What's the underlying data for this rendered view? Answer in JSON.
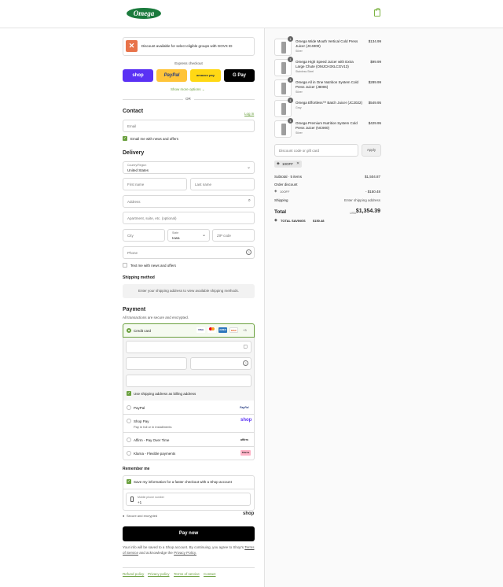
{
  "header": {
    "logo_text": "Omega"
  },
  "discount_banner": {
    "text": "Discount available for select eligible groups with GOVX ID"
  },
  "express": {
    "title": "Express checkout",
    "buttons": [
      {
        "label": "shop",
        "bg": "#5a31f4",
        "color": "#ffffff"
      },
      {
        "label": "PayPal",
        "bg": "#ffc439",
        "color": "#253b80"
      },
      {
        "label": "amazon pay",
        "bg": "#ffd814",
        "color": "#232f3e"
      },
      {
        "label": "G Pay",
        "bg": "#000000",
        "color": "#ffffff"
      }
    ],
    "show_more": "Show more options",
    "or": "OR"
  },
  "contact": {
    "title": "Contact",
    "login": "Log in",
    "email_placeholder": "Email",
    "email_news": "Email me with news and offers"
  },
  "delivery": {
    "title": "Delivery",
    "country_label": "Country/Region",
    "country_value": "United States",
    "first_name": "First name",
    "last_name": "Last name",
    "address": "Address",
    "apartment": "Apartment, suite, etc. (optional)",
    "city": "City",
    "state_label": "State",
    "state_value": "Iowa",
    "zip": "ZIP code",
    "phone": "Phone",
    "text_news": "Text me with news and offers"
  },
  "shipping": {
    "title": "Shipping method",
    "notice": "Enter your shipping address to view available shipping methods."
  },
  "payment": {
    "title": "Payment",
    "subtitle": "All transactions are secure and encrypted.",
    "credit_card": "Credit card",
    "card_logos": [
      "VISA",
      "MC",
      "AMEX",
      "DISC"
    ],
    "more_cards": "+3",
    "billing_same": "Use shipping address as billing address",
    "methods": [
      {
        "label": "PayPal",
        "sub": "",
        "logo": "PayPal"
      },
      {
        "label": "Shop Pay",
        "sub": "Pay in full or in installments",
        "logo": "shop"
      },
      {
        "label": "Affirm - Pay Over Time",
        "sub": "",
        "logo": "affirm"
      },
      {
        "label": "Klarna - Flexible payments",
        "sub": "",
        "logo": "Klarna"
      }
    ]
  },
  "remember": {
    "title": "Remember me",
    "save_info": "Save my information for a faster checkout with a Shop account",
    "mobile_label": "Mobile phone number",
    "mobile_value": "+1",
    "secure": "Secure and encrypted",
    "shop_logo": "shop"
  },
  "pay_now": "Pay now",
  "legal": {
    "text_before": "Your info will be saved to a Shop account. By continuing, you agree to Shop's",
    "terms": "Terms of Service",
    "and": "and acknowledge the",
    "privacy": "Privacy Policy."
  },
  "footer_links": [
    "Refund policy",
    "Privacy policy",
    "Terms of service",
    "Contact"
  ],
  "cart": {
    "items": [
      {
        "qty": "1",
        "name": "Omega Wide Mouth Vertical Cold Press Juicer (JC4000)",
        "variant": "Silver",
        "price": "$134.99"
      },
      {
        "qty": "1",
        "name": "Omega High Speed Juicer with Extra Large Chute (OMJCH3XLCGV13)",
        "variant": "Stainless Steel",
        "price": "$99.99"
      },
      {
        "qty": "1",
        "name": "Omega All in One Nutrition System Cold Press Juicer (J8006)",
        "variant": "Silver",
        "price": "$289.99"
      },
      {
        "qty": "1",
        "name": "Omega Effortless™ Batch Juicer (JC2022)",
        "variant": "Gray",
        "price": "$549.95"
      },
      {
        "qty": "1",
        "name": "Omega Premium Nutrition System Cold Press Juicer (NC900)",
        "variant": "Silver",
        "price": "$429.95"
      }
    ],
    "discount_placeholder": "Discount code or gift card",
    "apply": "Apply",
    "code_tag": "10OFF",
    "subtotal_label": "Subtotal · 5 items",
    "subtotal": "$1,504.87",
    "order_discount": "Order discount",
    "discount_code": "10OFF",
    "discount_amount": "- $150.48",
    "shipping_label": "Shipping",
    "shipping_value": "Enter shipping address",
    "total_label": "Total",
    "currency": "USD",
    "total": "$1,354.39",
    "savings_label": "TOTAL SAVINGS",
    "savings": "$150.48"
  },
  "colors": {
    "accent": "#6aa03e",
    "brand": "#1a7a3c",
    "dark": "#000000"
  }
}
